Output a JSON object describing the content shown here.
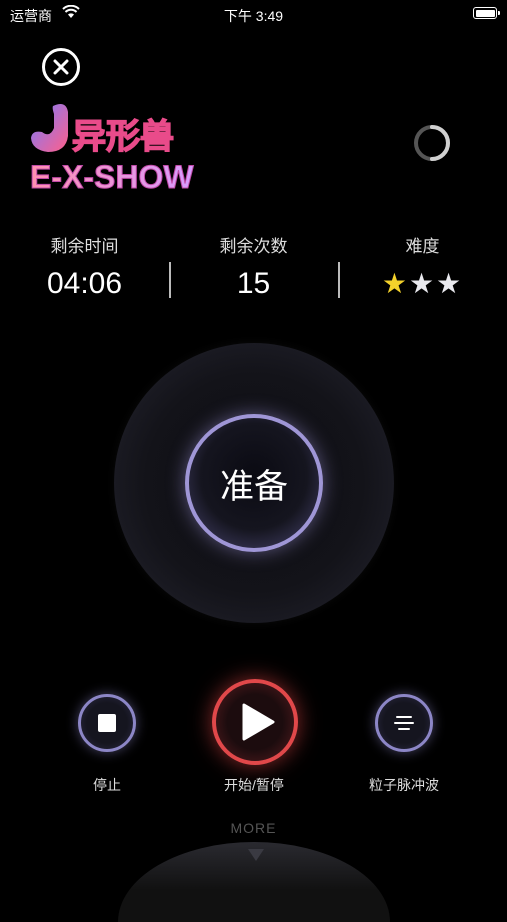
{
  "status_bar": {
    "carrier": "运营商",
    "time": "下午 3:49",
    "battery_level": 1.0
  },
  "logo": {
    "chinese": "异形兽",
    "latin": "E-X-SHOW"
  },
  "stats": {
    "remaining_time_label": "剩余时间",
    "remaining_time": "04:06",
    "remaining_count_label": "剩余次数",
    "remaining_count": "15",
    "difficulty_label": "难度",
    "difficulty_stars": 1,
    "difficulty_max": 3
  },
  "main_button": {
    "label": "准备"
  },
  "controls": {
    "stop_label": "停止",
    "play_pause_label": "开始/暂停",
    "pulse_label": "粒子脉冲波"
  },
  "more_label": "MORE",
  "colors": {
    "accent_purple": "#9f96d6",
    "play_red": "#e0484a",
    "star_yellow": "#f4d22b"
  }
}
